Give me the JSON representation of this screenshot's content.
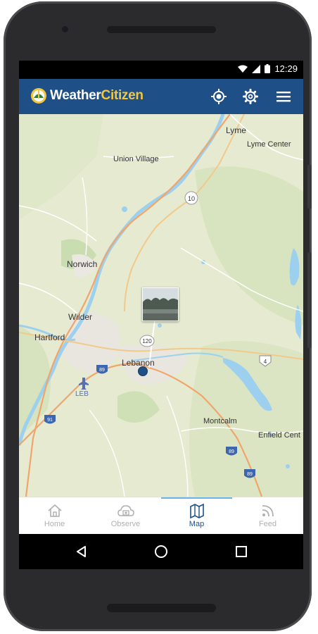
{
  "status_bar": {
    "time": "12:29"
  },
  "app_bar": {
    "brand_part1": "Weather",
    "brand_part2": "Citizen",
    "icons": [
      "location-target-icon",
      "gear-icon",
      "menu-icon"
    ]
  },
  "map": {
    "labels": {
      "lyme": "Lyme",
      "lyme_center": "Lyme Center",
      "union_village": "Union Village",
      "norwich": "Norwich",
      "wilder": "Wilder",
      "hartford": "Hartford",
      "lebanon": "Lebanon",
      "leb": "LEB",
      "montcalm": "Montcalm",
      "enfield_center": "Enfield Cent"
    },
    "shields": {
      "route_10": "10",
      "route_120": "120",
      "route_4": "4",
      "i89_a": "89",
      "i89_b": "89",
      "i89_c": "89",
      "i91": "91"
    }
  },
  "bottom_nav": {
    "items": [
      {
        "label": "Home",
        "icon": "home-icon"
      },
      {
        "label": "Observe",
        "icon": "camera-cloud-icon"
      },
      {
        "label": "Map",
        "icon": "map-icon"
      },
      {
        "label": "Feed",
        "icon": "rss-feed-icon"
      }
    ],
    "active": "Map"
  },
  "colors": {
    "app_bar": "#1e4f86",
    "brand_accent": "#f3c63f",
    "active_tab": "#69b3e7",
    "inactive_tab": "#b0b0b0"
  }
}
